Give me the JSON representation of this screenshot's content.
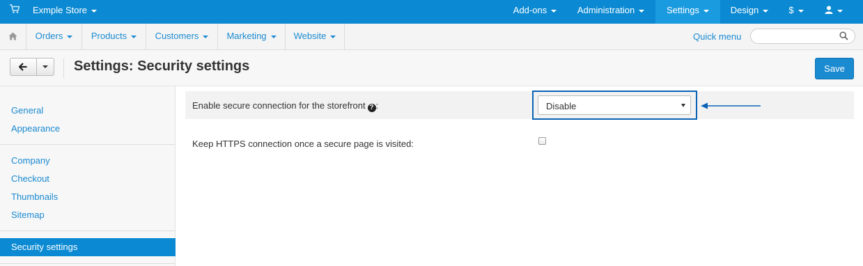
{
  "topbar": {
    "store_label": "Exmple Store",
    "nav": [
      "Add-ons",
      "Administration",
      "Settings",
      "Design",
      "$",
      ""
    ],
    "active": "Settings",
    "bg_color": "#0b8ad3"
  },
  "nav2": {
    "items": [
      "Orders",
      "Products",
      "Customers",
      "Marketing",
      "Website"
    ],
    "quick_menu": "Quick menu",
    "search_value": "",
    "search_placeholder": ""
  },
  "header": {
    "title": "Settings: Security settings",
    "save_label": "Save"
  },
  "sidebar": {
    "group1": [
      "General",
      "Appearance"
    ],
    "group2": [
      "Company",
      "Checkout",
      "Thumbnails",
      "Sitemap"
    ],
    "active": "Security settings"
  },
  "main": {
    "setting1_label": "Enable secure connection for the storefront",
    "setting1_suffix": ":",
    "setting1_value": "Disable",
    "setting2_label": "Keep HTTPS connection once a secure page is visited:",
    "setting2_checked": false
  },
  "icons": {
    "cart": "cart-icon",
    "home": "home-icon",
    "search": "search-icon",
    "back": "back-arrow-icon",
    "user": "user-icon",
    "help": "question-circle-icon"
  },
  "colors": {
    "accent": "#1a8ad1",
    "annotation": "#0b63b5"
  }
}
